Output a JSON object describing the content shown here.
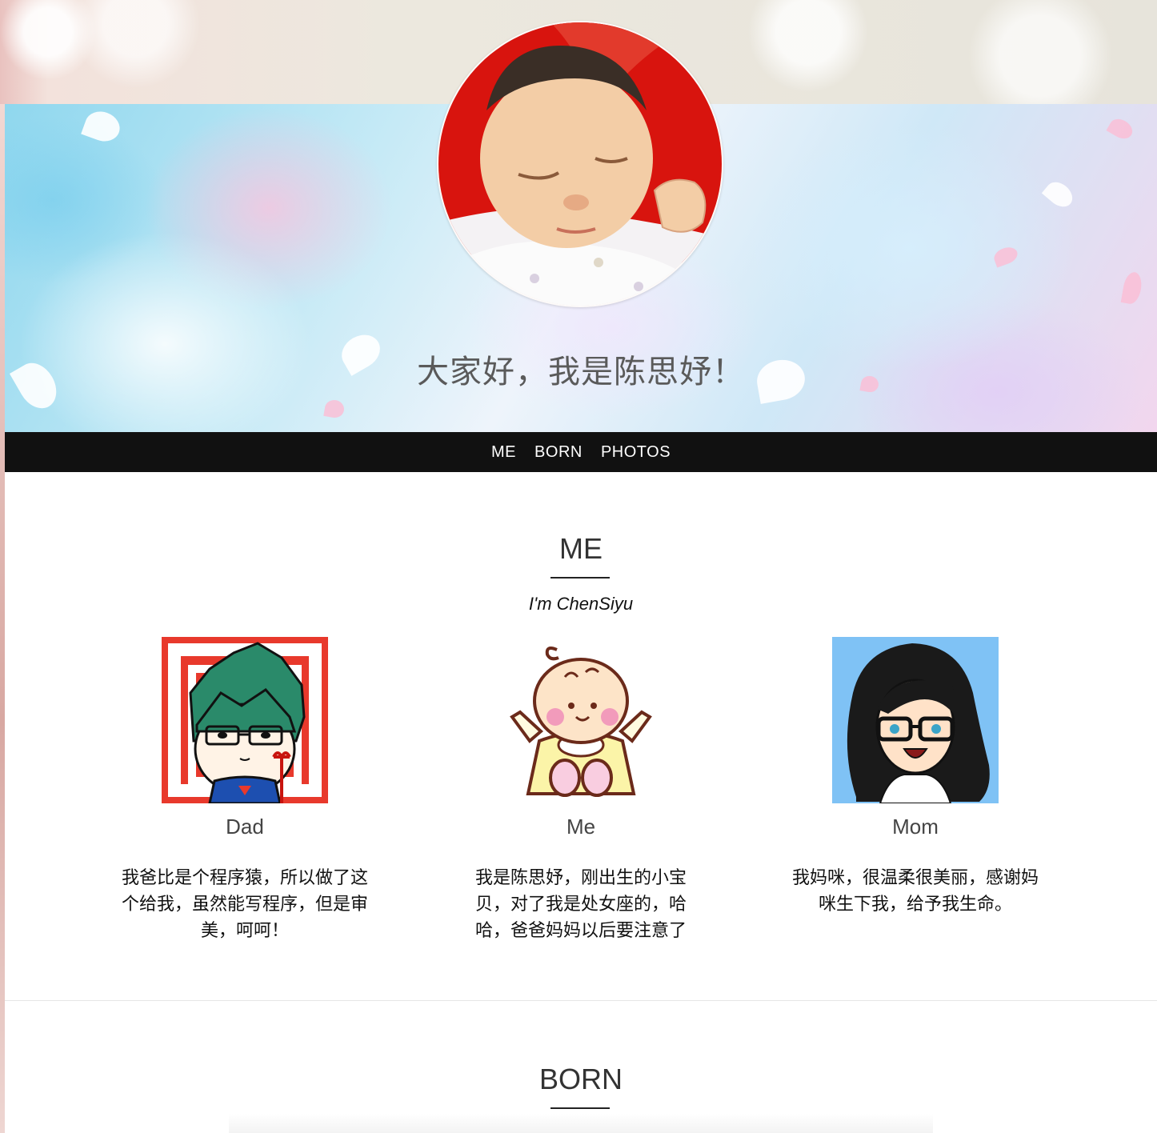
{
  "hero": {
    "title": "大家好，我是陈思妤！"
  },
  "nav": {
    "items": [
      "ME",
      "BORN",
      "PHOTOS"
    ]
  },
  "me_section": {
    "title": "ME",
    "subtitle": "I'm ChenSiyu",
    "members": [
      {
        "name": "Dad",
        "bio": "我爸比是个程序猿，所以做了这个给我，虽然能写程序，但是审美，呵呵！"
      },
      {
        "name": "Me",
        "bio": "我是陈思妤，刚出生的小宝贝，对了我是处女座的，哈哈，爸爸妈妈以后要注意了"
      },
      {
        "name": "Mom",
        "bio": "我妈咪，很温柔很美丽，感谢妈咪生下我，给予我生命。"
      }
    ]
  },
  "born_section": {
    "title": "BORN"
  },
  "colors": {
    "nav_bg": "#111111",
    "dad_bg": "#e8392c",
    "mom_bg": "#7fc2f5",
    "baby_blanket": "#d8140e"
  }
}
